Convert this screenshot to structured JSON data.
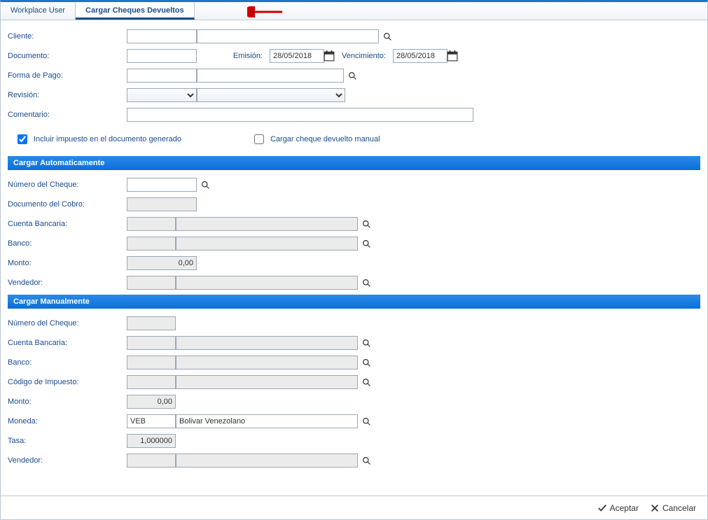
{
  "tabs": {
    "user": "Workplace User",
    "main": "Cargar Cheques Devueltos"
  },
  "header": {
    "cliente_lbl": "Cliente:",
    "documento_lbl": "Documento:",
    "emision_lbl": "Emisión:",
    "emision_val": "28/05/2018",
    "vencimiento_lbl": "Vencimiento:",
    "vencimiento_val": "28/05/2018",
    "formapago_lbl": "Forma de Pago:",
    "revision_lbl": "Revisión:",
    "comentario_lbl": "Comentario:",
    "chk_impuesto": "Incluir impuesto en el documento generado",
    "chk_manual": "Cargar cheque devuelto manual"
  },
  "auto": {
    "section": "Cargar Automaticamente",
    "numcheque_lbl": "Número del Cheque:",
    "doccobro_lbl": "Documento del Cobro:",
    "cuenta_lbl": "Cuenta Bancaria:",
    "banco_lbl": "Banco:",
    "monto_lbl": "Monto:",
    "monto_val": "0,00",
    "vendedor_lbl": "Vendedor:"
  },
  "manual": {
    "section": "Cargar Manualmente",
    "numcheque_lbl": "Número del Cheque:",
    "cuenta_lbl": "Cuenta Bancaria:",
    "banco_lbl": "Banco:",
    "codimp_lbl": "Código de Impuesto:",
    "monto_lbl": "Monto:",
    "monto_val": "0,00",
    "moneda_lbl": "Moneda:",
    "moneda_code": "VEB",
    "moneda_name": "Bolivar Venezolano",
    "tasa_lbl": "Tasa:",
    "tasa_val": "1,000000",
    "vendedor_lbl": "Vendedor:"
  },
  "footer": {
    "aceptar": "Aceptar",
    "cancelar": "Cancelar"
  }
}
